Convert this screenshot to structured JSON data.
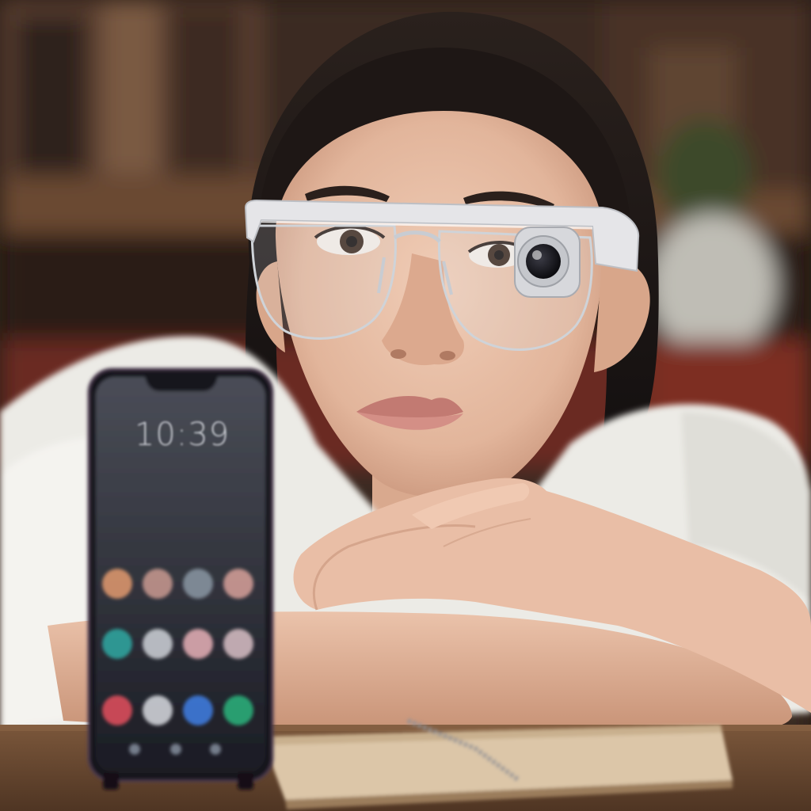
{
  "phone": {
    "clock": "10:39",
    "frame_color": "#17151c",
    "screen_top_color": "#4a4d57",
    "screen_bottom_color": "#1b1c24",
    "app_icons": [
      {
        "name": "app-icon-orange",
        "color": "#e39a6f"
      },
      {
        "name": "app-icon-multicolor",
        "color": "#c99a90"
      },
      {
        "name": "app-icon-grey",
        "color": "#8a96a3"
      },
      {
        "name": "app-icon-peach",
        "color": "#d7a19a"
      },
      {
        "name": "app-icon-teal",
        "color": "#2fa9a2"
      },
      {
        "name": "app-icon-white",
        "color": "#cfd2d8"
      },
      {
        "name": "app-icon-pink",
        "color": "#e7b0b7"
      },
      {
        "name": "app-icon-rose",
        "color": "#d9bfc5"
      },
      {
        "name": "dock-icon-red",
        "color": "#e4505e"
      },
      {
        "name": "dock-icon-white",
        "color": "#d8dbe0"
      },
      {
        "name": "dock-icon-blue",
        "color": "#3f7fe5"
      },
      {
        "name": "dock-icon-green",
        "color": "#29b47d"
      }
    ]
  },
  "glasses": {
    "frame_color": "#e5e5e8",
    "camera_lens_color": "#15151a"
  },
  "palette": {
    "background_wood": "#5a3c28",
    "bookshelf_dark": "#2d211a",
    "skin": "#e6bca4",
    "hair": "#1b1614",
    "shirt": "#ecebe6",
    "desk": "#6e4f36",
    "notebook": "#dcc6a8"
  }
}
